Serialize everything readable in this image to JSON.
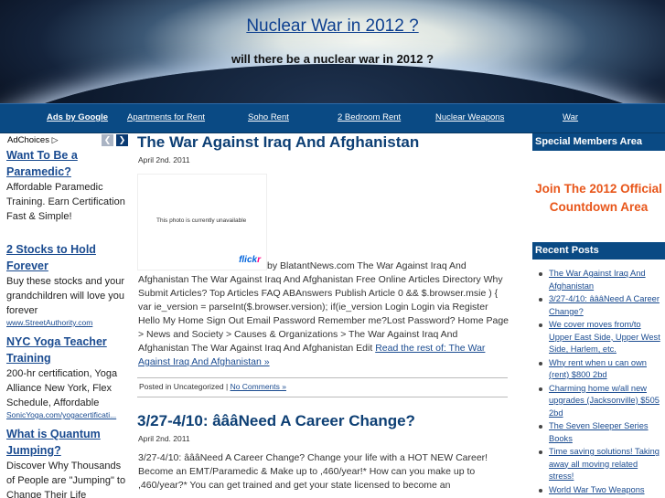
{
  "header": {
    "title": "Nuclear War in 2012 ?",
    "description": "will there be a nuclear war in 2012 ?"
  },
  "nav": {
    "ads_label": "Ads by Google",
    "links": [
      "Apartments for Rent",
      "Soho Rent",
      "2 Bedroom Rent",
      "Nuclear Weapons",
      "War"
    ]
  },
  "left_ads": {
    "adchoices": "AdChoices",
    "prev_icon": "chevron-left-icon",
    "next_icon": "chevron-right-icon",
    "ads": [
      {
        "title": "Want To Be a Paramedic?",
        "body": "Affordable Paramedic Training. Earn Certification Fast & Simple!",
        "url": ""
      },
      {
        "title": "2 Stocks to Hold Forever",
        "body": "Buy these stocks and your grandchildren will love you forever",
        "url": "www.StreetAuthority.com"
      },
      {
        "title": "NYC Yoga Teacher Training",
        "body": "200-hr certification, Yoga Alliance New York, Flex Schedule, Affordable",
        "url": "SonicYoga.com/yogacertificati..."
      },
      {
        "title": "What is Quantum Jumping?",
        "body": "Discover Why Thousands of People are \"Jumping\" to Change Their Life",
        "url": ""
      }
    ]
  },
  "posts": [
    {
      "title": "The War Against Iraq And Afghanistan",
      "date": "April 2nd. 2011",
      "image_message": "This photo is currently unavailable",
      "image_logo_a": "flick",
      "image_logo_b": "r",
      "text": "by BlatantNews.com The War Against Iraq And Afghanistan The War Against Iraq And Afghanistan Free Online Articles Directory Why Submit Articles? Top Articles FAQ ABAnswers Publish Article 0 && $.browser.msie ) { var ie_version = parseInt($.browser.version); if(ie_version Login Login via Register Hello My Home Sign Out Email Password Remember me?Lost Password? Home Page > News and Society > Causes & Organizations > The War Against Iraq And Afghanistan The War Against Iraq And Afghanistan Edit",
      "read_more": "Read the rest of: The War Against Iraq And Afghanistan »",
      "meta_prefix": "Posted in Uncategorized |",
      "comments": "No Comments »"
    },
    {
      "title": "3/27-4/10: âââNeed A Career Change?",
      "date": "April 2nd. 2011",
      "text": "3/27-4/10: âââNeed A Career Change? Change your life with a HOT NEW Career! Become an EMT/Paramedic & Make up to ,460/year!* How can you make up to ,460/year?* You can get trained and get your state licensed to become an"
    }
  ],
  "sidebar": {
    "members_heading": "Special Members Area",
    "join_text": "Join The 2012 Official Countdown Area",
    "recent_heading": "Recent Posts",
    "recent_posts": [
      "The War Against Iraq And Afghanistan",
      "3/27-4/10: âââNeed A Career Change?",
      "We cover moves from/to Upper East Side, Upper West Side, Harlem, etc.",
      "Why rent when u can own (rent) $800 2bd",
      "Charming home w/all new upgrades (Jacksonville) $505 2bd",
      "The Seven Sleeper Series Books",
      "Time saving solutions! Taking away all moving related stress!",
      "World War Two Weapons"
    ]
  },
  "colors": {
    "nav_bg": "#0a4a84",
    "link": "#1a4b90",
    "post_title": "#0d3f74",
    "join_accent": "#e8561a"
  }
}
